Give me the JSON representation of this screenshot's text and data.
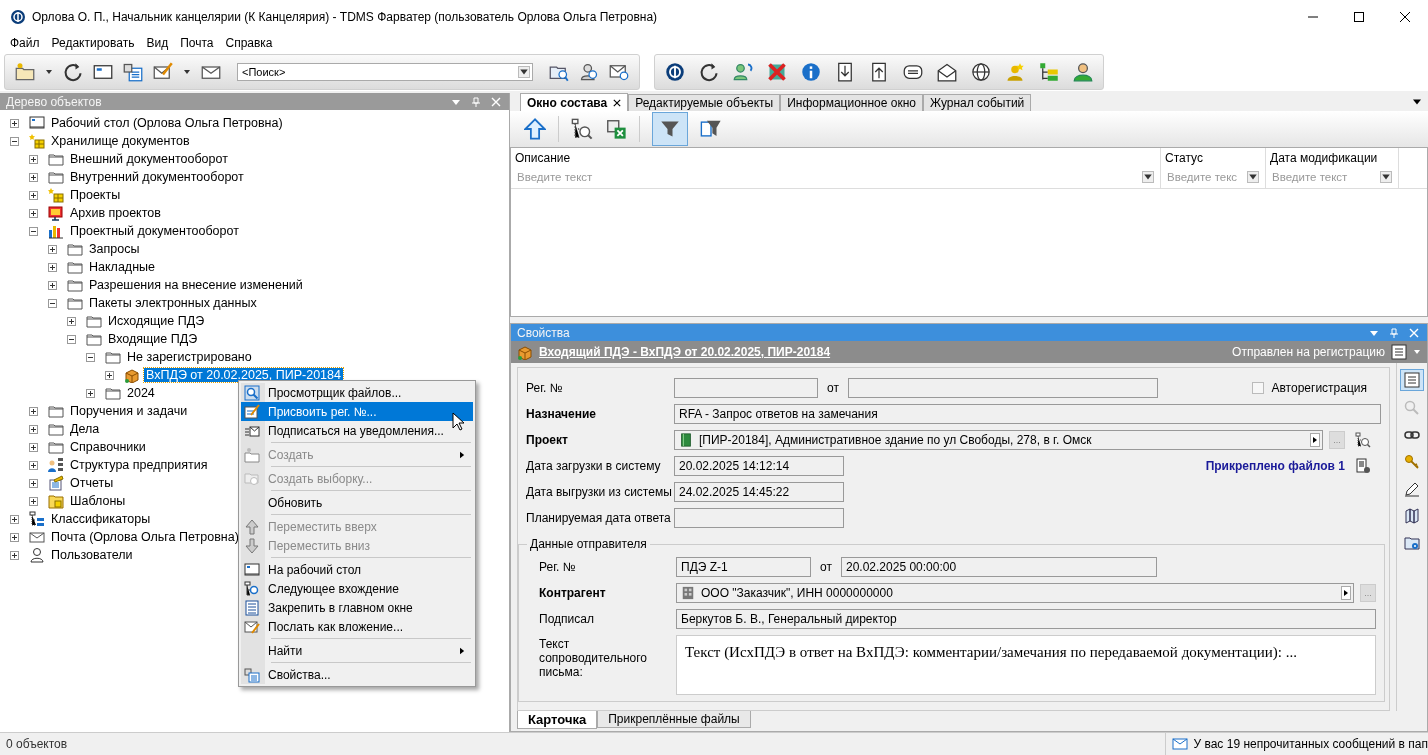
{
  "window": {
    "title": "Орлова О. П., Начальник канцелярии (К Канцелярия) - TDMS Фарватер (пользователь Орлова Ольга Петровна)"
  },
  "menu_bar": [
    "Файл",
    "Редактировать",
    "Вид",
    "Почта",
    "Справка"
  ],
  "toolbar": {
    "search": {
      "value": "<Поиск>"
    }
  },
  "tree_panel": {
    "title": "Дерево объектов",
    "items": [
      {
        "label": "Рабочий стол (Орлова Ольга Петровна)",
        "kind": "desktop",
        "expanded": false,
        "selected": false
      },
      {
        "label": "Хранилище документов",
        "kind": "storage",
        "expanded": true,
        "selected": false,
        "children": [
          {
            "label": "Внешний документооборот",
            "kind": "folder",
            "expanded": false,
            "selected": false
          },
          {
            "label": "Внутренний документооборот",
            "kind": "folder",
            "expanded": false,
            "selected": false
          },
          {
            "label": "Проекты",
            "kind": "storage",
            "expanded": false,
            "selected": false
          },
          {
            "label": "Архив проектов",
            "kind": "archive",
            "expanded": false,
            "selected": false
          },
          {
            "label": "Проектный документооборот",
            "kind": "chart",
            "expanded": true,
            "selected": false,
            "children": [
              {
                "label": "Запросы",
                "kind": "folder",
                "expanded": false,
                "selected": false
              },
              {
                "label": "Накладные",
                "kind": "folder",
                "expanded": false,
                "selected": false
              },
              {
                "label": "Разрешения на внесение изменений",
                "kind": "folder",
                "expanded": false,
                "selected": false
              },
              {
                "label": "Пакеты электронных данных",
                "kind": "folder",
                "expanded": true,
                "selected": false,
                "children": [
                  {
                    "label": "Исходящие ПДЭ",
                    "kind": "folder",
                    "expanded": false,
                    "selected": false
                  },
                  {
                    "label": "Входящие ПДЭ",
                    "kind": "folder",
                    "expanded": true,
                    "selected": false,
                    "children": [
                      {
                        "label": "Не зарегистрировано",
                        "kind": "folder",
                        "expanded": true,
                        "selected": false,
                        "children": [
                          {
                            "label": "ВхПДЭ от 20.02.2025, ПИР-20184",
                            "kind": "package",
                            "expanded": false,
                            "selected": true
                          }
                        ]
                      },
                      {
                        "label": "2024",
                        "kind": "folder",
                        "expanded": false,
                        "selected": false
                      }
                    ]
                  }
                ]
              }
            ]
          },
          {
            "label": "Поручения и задачи",
            "kind": "folder",
            "expanded": false,
            "selected": false
          },
          {
            "label": "Дела",
            "kind": "folder",
            "expanded": false,
            "selected": false
          },
          {
            "label": "Справочники",
            "kind": "folder",
            "expanded": false,
            "selected": false
          },
          {
            "label": "Структура предприятия",
            "kind": "structure",
            "expanded": false,
            "selected": false
          },
          {
            "label": "Отчеты",
            "kind": "reports",
            "expanded": false,
            "selected": false
          },
          {
            "label": "Шаблоны",
            "kind": "templates",
            "expanded": false,
            "selected": false
          }
        ]
      },
      {
        "label": "Классификаторы",
        "kind": "classifier",
        "expanded": false,
        "selected": false
      },
      {
        "label": "Почта (Орлова Ольга Петровна)",
        "kind": "mail",
        "expanded": false,
        "selected": false
      },
      {
        "label": "Пользователи",
        "kind": "users",
        "expanded": false,
        "selected": false
      }
    ]
  },
  "context_menu": {
    "items": [
      {
        "label": "Просмотрщик файлов...",
        "kind": "viewer",
        "disabled": false,
        "selected": false,
        "submenu": false,
        "separator_before": false
      },
      {
        "label": "Присвоить рег. №...",
        "kind": "edit",
        "disabled": false,
        "selected": true,
        "submenu": false,
        "separator_before": false
      },
      {
        "label": "Подписаться на уведомления...",
        "kind": "subscribe",
        "disabled": false,
        "selected": false,
        "submenu": false,
        "separator_before": false
      },
      {
        "label": "Создать",
        "kind": "create",
        "disabled": true,
        "selected": false,
        "submenu": true,
        "separator_before": true
      },
      {
        "label": "Создать выборку...",
        "kind": "query",
        "disabled": true,
        "selected": false,
        "submenu": false,
        "separator_before": true
      },
      {
        "label": "Обновить",
        "kind": "plain",
        "disabled": false,
        "selected": false,
        "submenu": false,
        "separator_before": true
      },
      {
        "label": "Переместить вверх",
        "kind": "up",
        "disabled": true,
        "selected": false,
        "submenu": false,
        "separator_before": true
      },
      {
        "label": "Переместить вниз",
        "kind": "down",
        "disabled": true,
        "selected": false,
        "submenu": false,
        "separator_before": false
      },
      {
        "label": "На рабочий стол",
        "kind": "desktop",
        "disabled": false,
        "selected": false,
        "submenu": false,
        "separator_before": true
      },
      {
        "label": "Следующее вхождение",
        "kind": "next",
        "disabled": false,
        "selected": false,
        "submenu": false,
        "separator_before": false
      },
      {
        "label": "Закрепить в главном окне",
        "kind": "pin",
        "disabled": false,
        "selected": false,
        "submenu": false,
        "separator_before": false
      },
      {
        "label": "Послать как вложение...",
        "kind": "send",
        "disabled": false,
        "selected": false,
        "submenu": false,
        "separator_before": false
      },
      {
        "label": "Найти",
        "kind": "plain",
        "disabled": false,
        "selected": false,
        "submenu": true,
        "separator_before": true
      },
      {
        "label": "Свойства...",
        "kind": "properties",
        "disabled": false,
        "selected": false,
        "submenu": false,
        "separator_before": true
      }
    ]
  },
  "tabs": [
    {
      "label": "Окно состава",
      "selected": true
    },
    {
      "label": "Редактируемые объекты",
      "selected": false
    },
    {
      "label": "Информационное окно",
      "selected": false
    },
    {
      "label": "Журнал событий",
      "selected": false
    }
  ],
  "list_view": {
    "columns": [
      {
        "label": "Описание",
        "placeholder": "Введите текст"
      },
      {
        "label": "Статус",
        "placeholder": "Введите текс"
      },
      {
        "label": "Дата модификации",
        "placeholder": "Введите текст"
      }
    ]
  },
  "properties": {
    "title": "Свойства",
    "object_title": "Входящий ПДЭ - ВхПДЭ от 20.02.2025, ПИР-20184",
    "status": "Отправлен на регистрацию",
    "reg_number": {
      "label": "Рег. №"
    },
    "date_label": "от",
    "autoreg": {
      "label": "Авторегистрация",
      "checked": false
    },
    "purpose": {
      "label": "Назначение",
      "value": "RFA - Запрос ответов на замечания",
      "required": true
    },
    "project": {
      "label": "Проект",
      "value": "[ПИР-20184], Административное здание по ул Свободы, 278, в г. Омск",
      "required": true,
      "more": "..."
    },
    "upload_date": {
      "label": "Дата загрузки в систему",
      "value": "20.02.2025 14:12:14"
    },
    "download_date": {
      "label": "Дата выгрузки из системы",
      "value": "24.02.2025 14:45:22"
    },
    "planned_date": {
      "label": "Планируемая дата ответа"
    },
    "attached": "Прикреплено файлов 1",
    "sender": {
      "title": "Данные отправителя",
      "reg_number": {
        "label": "Рег. №",
        "value": "ПДЭ Z-1"
      },
      "date_label": "от",
      "date": "20.02.2025 00:00:00",
      "counterparty": {
        "label": "Контрагент",
        "value": "ООО \"Заказчик\", ИНН 0000000000",
        "required": true,
        "more": "..."
      },
      "signed": {
        "label": "Подписал",
        "value": "Беркутов Б. В., Генеральный директор"
      },
      "letter": {
        "label": "Текст сопроводительного письма:",
        "value": "Текст (ИсхПДЭ в ответ на ВхПДЭ: комментарии/замечания по передаваемой документации): ..."
      }
    }
  },
  "bottom_tabs": [
    {
      "label": "Карточка",
      "selected": true
    },
    {
      "label": "Прикреплённые файлы",
      "selected": false
    }
  ],
  "status_bar": {
    "left": "0 объектов",
    "right": "У вас 19 непрочитанных сообщений в пап"
  }
}
